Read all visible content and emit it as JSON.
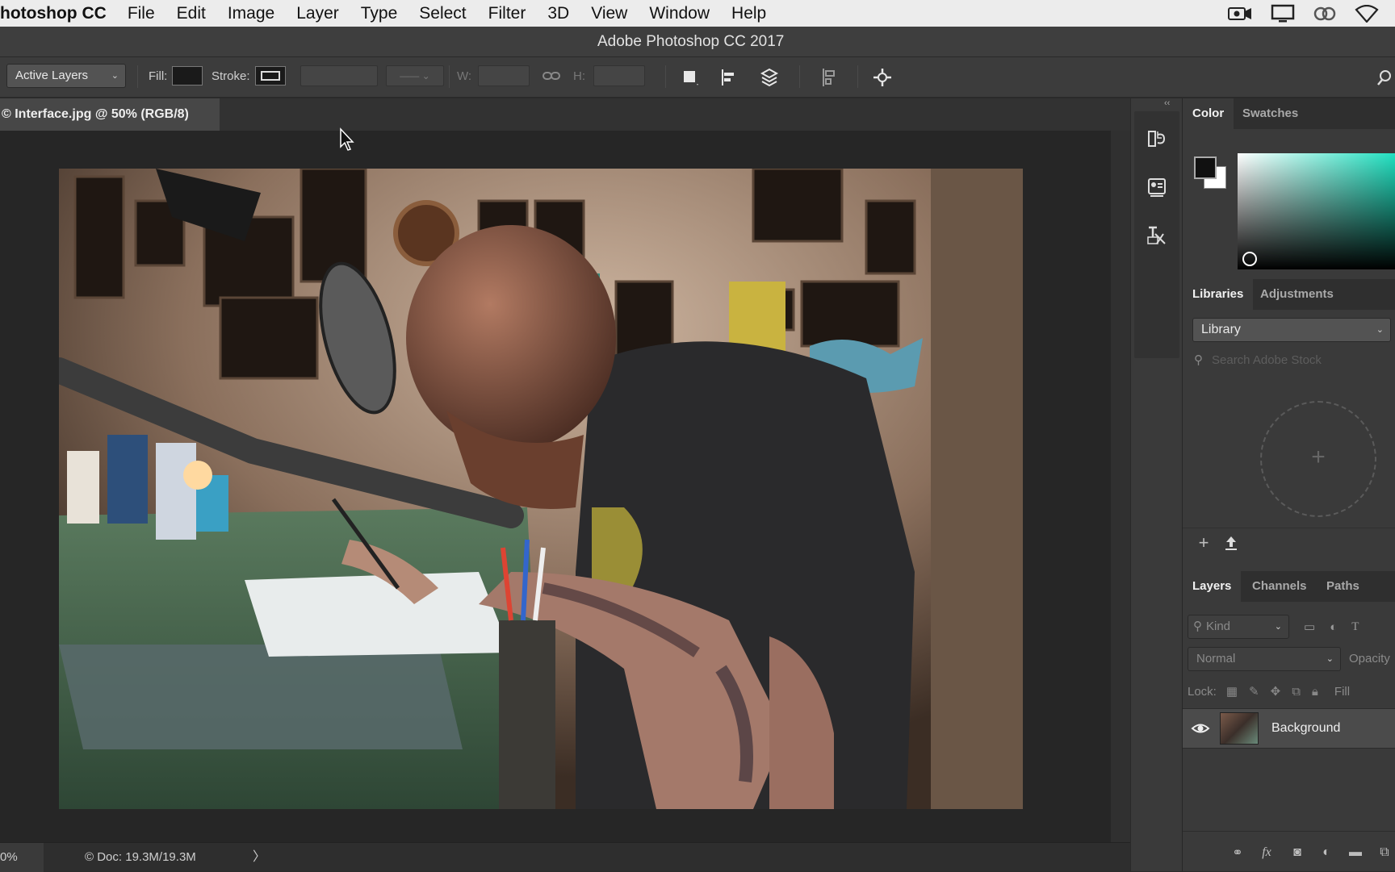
{
  "menubar": {
    "app_name": "hotoshop CC",
    "items": [
      "File",
      "Edit",
      "Image",
      "Layer",
      "Type",
      "Select",
      "Filter",
      "3D",
      "View",
      "Window",
      "Help"
    ],
    "tray_icons": [
      "screen-record-icon",
      "display-icon",
      "creative-cloud-icon",
      "wifi-icon"
    ]
  },
  "window": {
    "title": "Adobe Photoshop CC 2017"
  },
  "options": {
    "target_select": "Active Layers",
    "fill_label": "Fill:",
    "stroke_label": "Stroke:",
    "w_label": "W:",
    "h_label": "H:",
    "fill_color": "#1a1a1a"
  },
  "document": {
    "tab_label": "© Interface.jpg @ 50% (RGB/8)",
    "zoom": "0%",
    "doc_size": "© Doc: 19.3M/19.3M",
    "status_arrow": "〉"
  },
  "color_panel": {
    "tabs": [
      "Color",
      "Swatches"
    ],
    "foreground": "#111111",
    "background": "#ffffff",
    "hue": "#20e0c0"
  },
  "libraries_panel": {
    "tabs": [
      "Libraries",
      "Adjustments"
    ],
    "library_select": "Library",
    "search_placeholder": "Search Adobe Stock",
    "dropzone_plus": "+"
  },
  "layers_panel": {
    "tabs": [
      "Layers",
      "Channels",
      "Paths"
    ],
    "filter_kind": "Kind",
    "blend_mode": "Normal",
    "opacity_label": "Opacity",
    "lock_label": "Lock:",
    "fill_label": "Fill",
    "layers": [
      {
        "name": "Background",
        "visible": true
      }
    ]
  }
}
